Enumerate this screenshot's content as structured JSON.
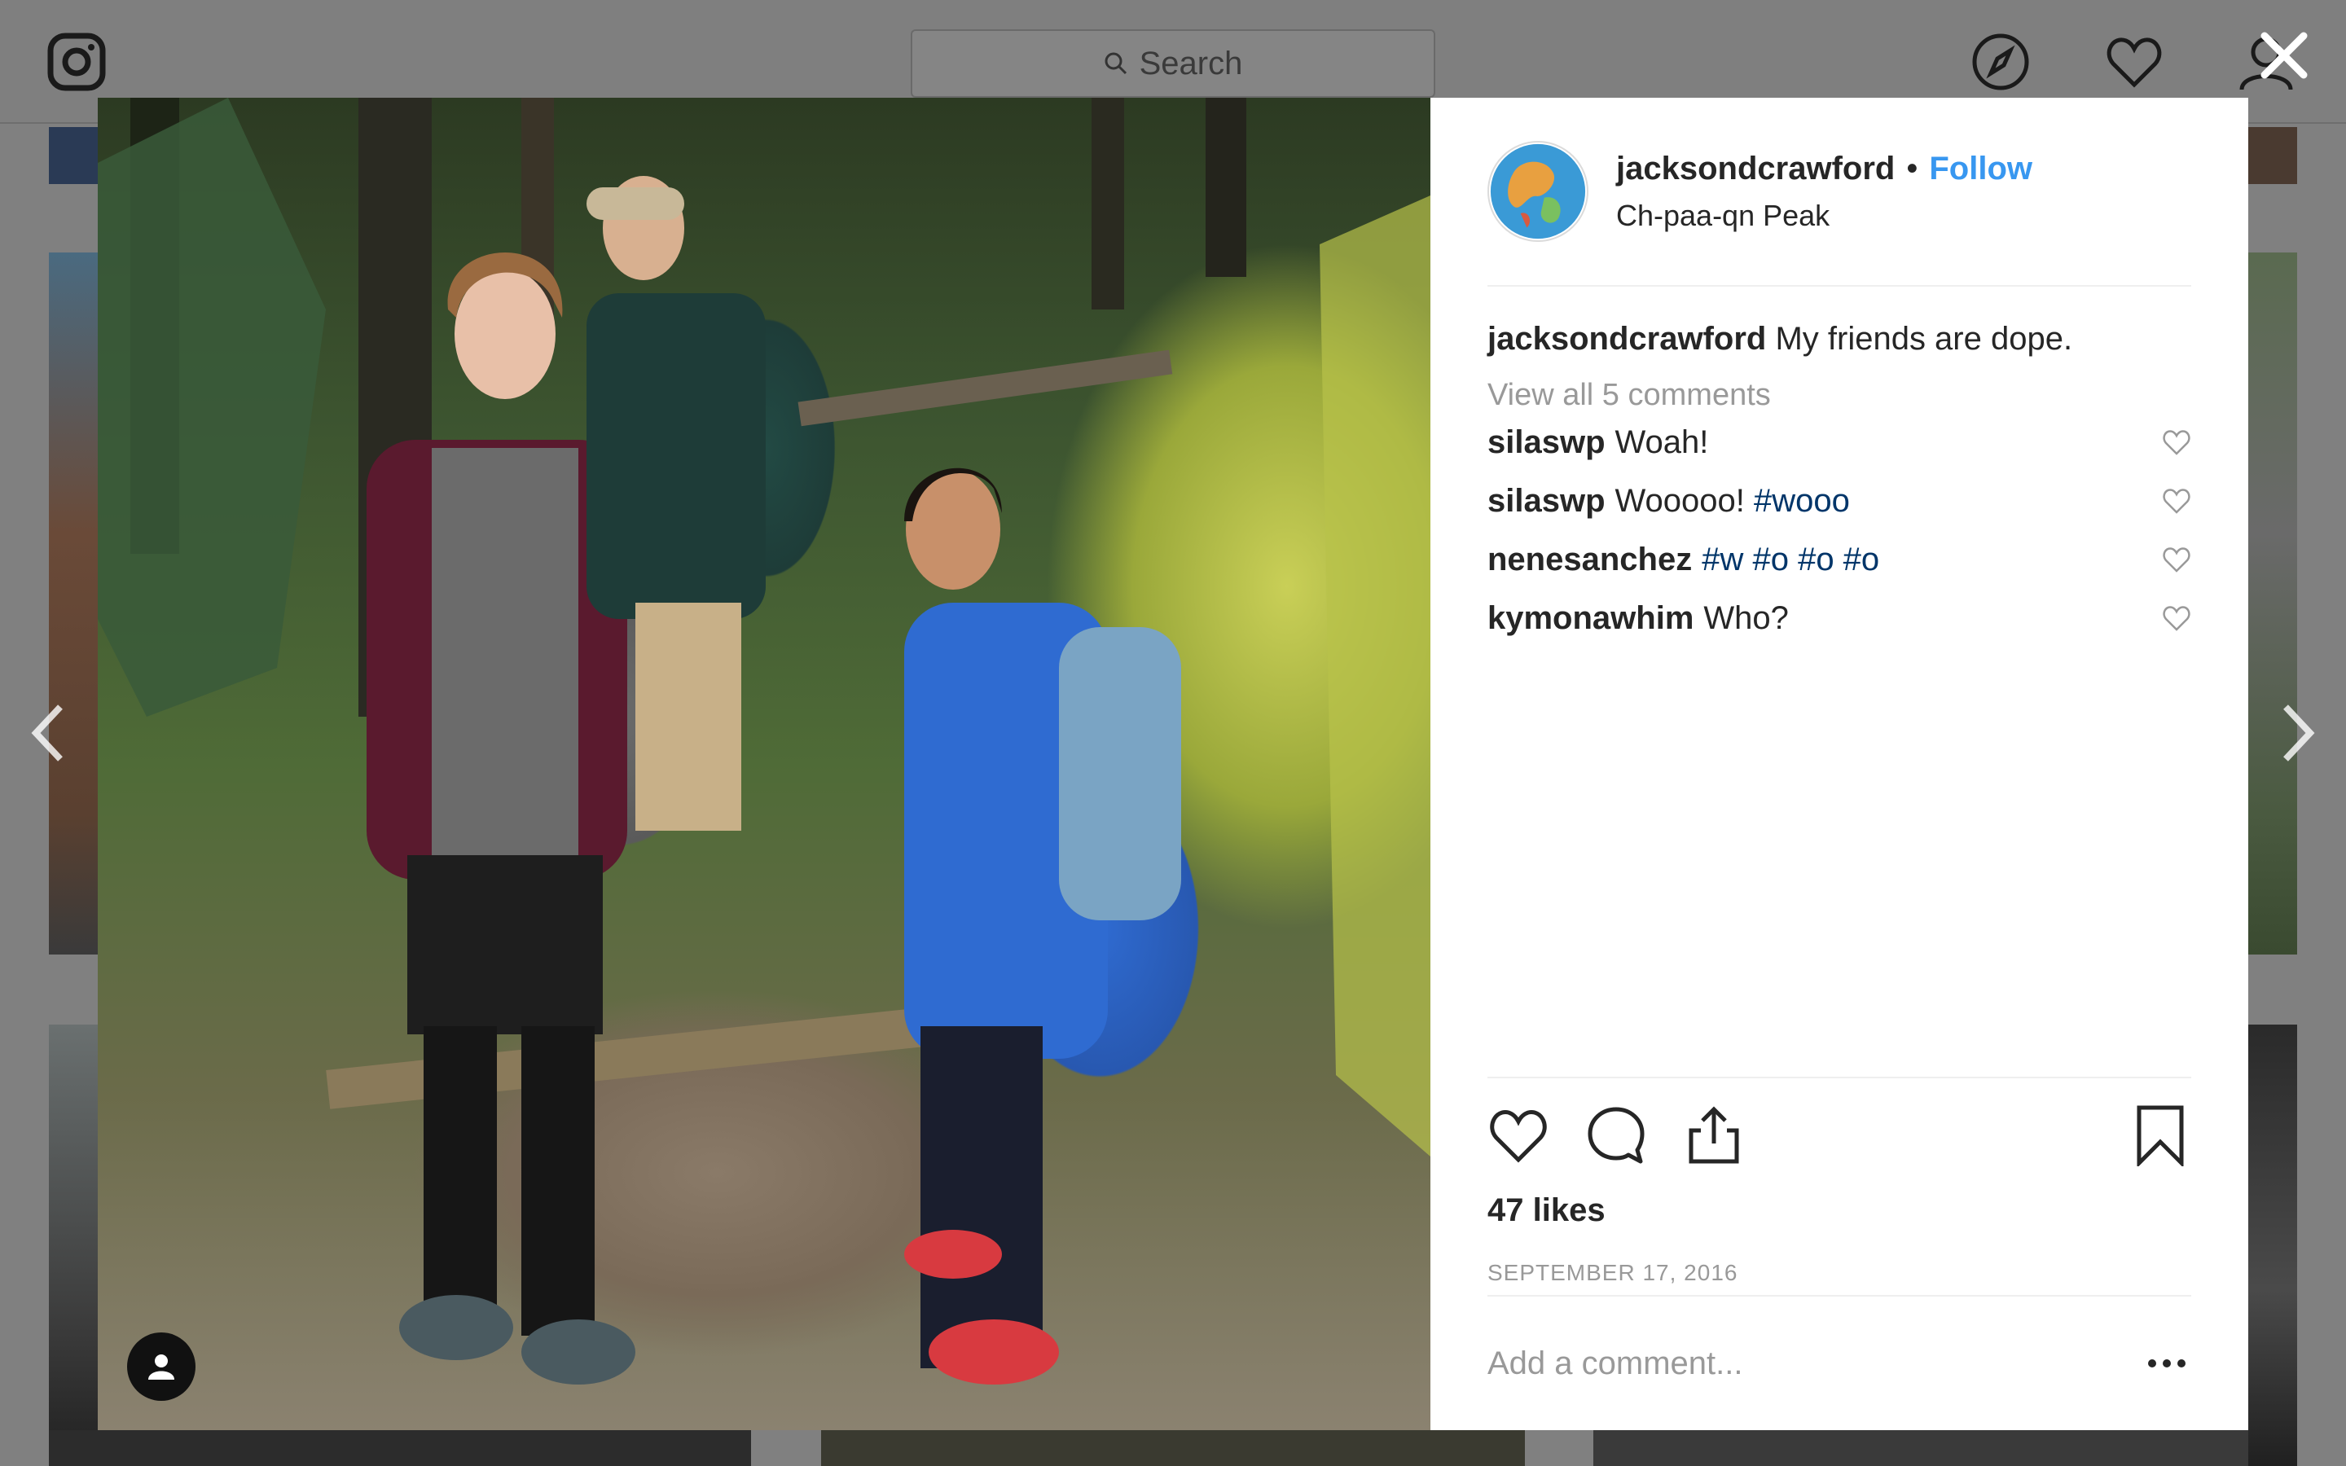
{
  "background": {
    "search_placeholder": "Search"
  },
  "post": {
    "username": "jacksondcrawford",
    "follow_label": "Follow",
    "separator": "•",
    "location": "Ch-paa-qn Peak",
    "caption_user": "jacksondcrawford",
    "caption_text": "My friends are dope.",
    "view_all_label": "View all 5 comments",
    "comments": [
      {
        "user": "silaswp",
        "text": "Woah!",
        "hashtags": ""
      },
      {
        "user": "silaswp",
        "text": "Wooooo!",
        "hashtags": "#wooo"
      },
      {
        "user": "nenesanchez",
        "text": "",
        "hashtags": "#w #o #o #o"
      },
      {
        "user": "kymonawhim",
        "text": "Who?",
        "hashtags": ""
      }
    ],
    "likes": "47 likes",
    "date": "SEPTEMBER 17, 2016",
    "add_comment_placeholder": "Add a comment..."
  },
  "icons": {
    "header": [
      "instagram-logo-icon",
      "search-icon",
      "compass-icon",
      "heart-icon",
      "profile-icon"
    ],
    "actions": [
      "like-heart-icon",
      "comment-bubble-icon",
      "share-icon",
      "bookmark-icon"
    ],
    "misc": [
      "close-icon",
      "chevron-left-icon",
      "chevron-right-icon",
      "tag-user-icon",
      "more-options-icon"
    ]
  },
  "colors": {
    "accent": "#3897f0",
    "hashtag": "#003569",
    "muted": "#999999",
    "overlay": "#808080"
  }
}
